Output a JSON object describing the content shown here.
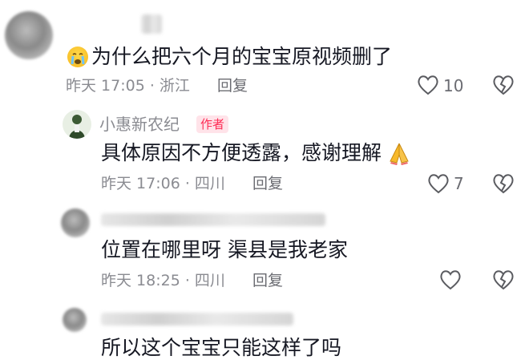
{
  "comments": [
    {
      "emoji": "loudly-crying-face-icon",
      "text": "为什么把六个月的宝宝原视频删了",
      "meta": "昨天 17:05 · 浙江",
      "reply_label": "回复",
      "likes": "10"
    },
    {
      "author": "小惠新农纪",
      "badge": "作者",
      "text": "具体原因不方便透露，感谢理解",
      "emoji": "folded-hands-icon",
      "meta": "昨天 17:06 · 四川",
      "reply_label": "回复",
      "likes": "7"
    },
    {
      "text": "位置在哪里呀 渠县是我老家",
      "meta": "昨天 18:25 · 四川",
      "reply_label": "回复",
      "likes": ""
    },
    {
      "text": "所以这个宝宝只能这样了吗"
    }
  ],
  "colors": {
    "author_badge": "#fe2c55",
    "meta_text": "#8a8b91",
    "icon": "#5a5b60"
  }
}
